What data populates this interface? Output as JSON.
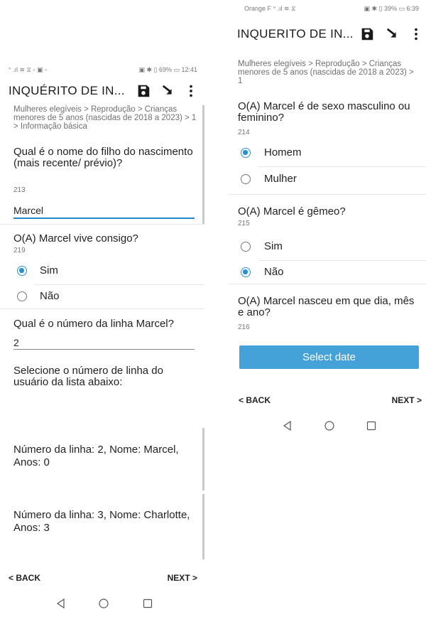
{
  "left_screen": {
    "status_bar": {
      "left": "ᐡ .ıl ≋ ⧖ ◦ ▣ ◦",
      "right": "▣ ✱ ▯ 69% ▭ 12:41"
    },
    "app_title": "INQUÉRITO DE IN...",
    "breadcrumb": "Mulheres elegíveis > Reprodução > Crianças menores de 5 anos (nascidas de 2018 a 2023) > 1 > Informação básica",
    "q1": {
      "title": "Qual é o nome do filho do nascimento (mais recente/ prévio)?",
      "code": "213",
      "value": "Marcel"
    },
    "q2": {
      "title": "O(A) Marcel vive consigo?",
      "code": "219",
      "options": [
        "Sim",
        "Não"
      ],
      "selected": "Sim"
    },
    "q3": {
      "title": "Qual é o número da linha Marcel?",
      "value": "2"
    },
    "q4": {
      "title": "Selecione o número de linha do usuário da lista abaixo:"
    },
    "entries": [
      "Número da linha: 2, Nome: Marcel, Anos: 0",
      "Número da linha: 3, Nome: Charlotte, Anos: 3"
    ],
    "nav": {
      "back": "< BACK",
      "next": "NEXT >"
    }
  },
  "right_screen": {
    "status_bar": {
      "left": "Orange F ᐡ .ıl ≋ ⧖",
      "right": "▣ ✱ ▯ 39% ▭ 6:39"
    },
    "app_title": "INQUERITO DE IN...",
    "breadcrumb": "Mulheres elegíveis > Reprodução > Crianças menores de 5 anos (nascidas de 2018 a 2023) > 1",
    "q1": {
      "title": "O(A) Marcel é de sexo masculino ou feminino?",
      "code": "214",
      "options": [
        "Homem",
        "Mulher"
      ],
      "selected": "Homem"
    },
    "q2": {
      "title": "O(A) Marcel é gêmeo?",
      "code": "215",
      "options": [
        "Sim",
        "Não"
      ],
      "selected": "Não"
    },
    "q3": {
      "title": "O(A) Marcel nasceu em que dia, mês e ano?",
      "code": "216",
      "button": "Select date"
    },
    "nav": {
      "back": "< BACK",
      "next": "NEXT >"
    }
  },
  "colors": {
    "accent": "#2b8fd3",
    "button": "#45a2d8",
    "text": "#222222",
    "muted": "#777777"
  },
  "icons": [
    "save-icon",
    "sync-icon",
    "more-vert-icon",
    "radio-checked-icon",
    "radio-unchecked-icon",
    "back-triangle-icon",
    "home-circle-icon",
    "recents-square-icon"
  ]
}
